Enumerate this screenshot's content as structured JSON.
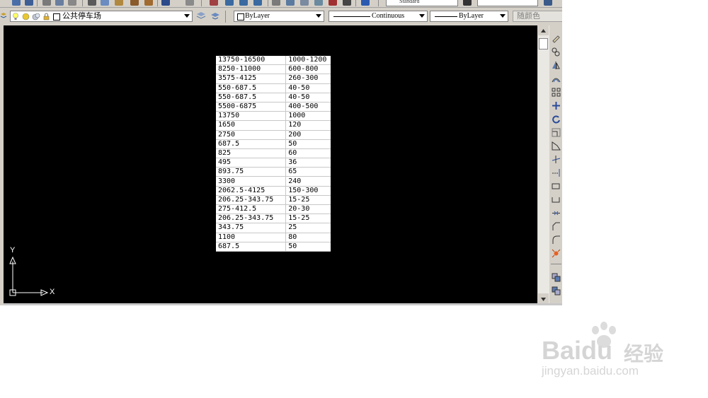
{
  "toolbar_top": {
    "text_style": "Standard"
  },
  "layer": {
    "name": "公共停车场"
  },
  "properties": {
    "color": "ByLayer",
    "linetype": "Continuous",
    "lineweight": "ByLayer",
    "plot_style": "随颜色"
  },
  "table": {
    "rows": [
      [
        "13750-16500",
        "1000-1200"
      ],
      [
        "8250-11000",
        "600-800"
      ],
      [
        "3575-4125",
        "260-300"
      ],
      [
        "550-687.5",
        "40-50"
      ],
      [
        "550-687.5",
        "40-50"
      ],
      [
        "5500-6875",
        "400-500"
      ],
      [
        "13750",
        "1000"
      ],
      [
        "1650",
        "120"
      ],
      [
        "2750",
        "200"
      ],
      [
        "687.5",
        "50"
      ],
      [
        "825",
        "60"
      ],
      [
        "495",
        "36"
      ],
      [
        "893.75",
        "65"
      ],
      [
        "3300",
        "240"
      ],
      [
        "2062.5-4125",
        "150-300"
      ],
      [
        "206.25-343.75",
        "15-25"
      ],
      [
        "275-412.5",
        "20-30"
      ],
      [
        "206.25-343.75",
        "15-25"
      ],
      [
        "343.75",
        "25"
      ],
      [
        "1100",
        "80"
      ],
      [
        "687.5",
        "50"
      ]
    ]
  },
  "ucs": {
    "x_label": "X",
    "y_label": "Y"
  },
  "watermark": {
    "brand": "Baidu",
    "cn": "经验",
    "url": "jingyan.baidu.com"
  },
  "colors": {
    "canvas": "#000000",
    "chrome": "#d4d0c8",
    "table_bg": "#ffffff"
  }
}
